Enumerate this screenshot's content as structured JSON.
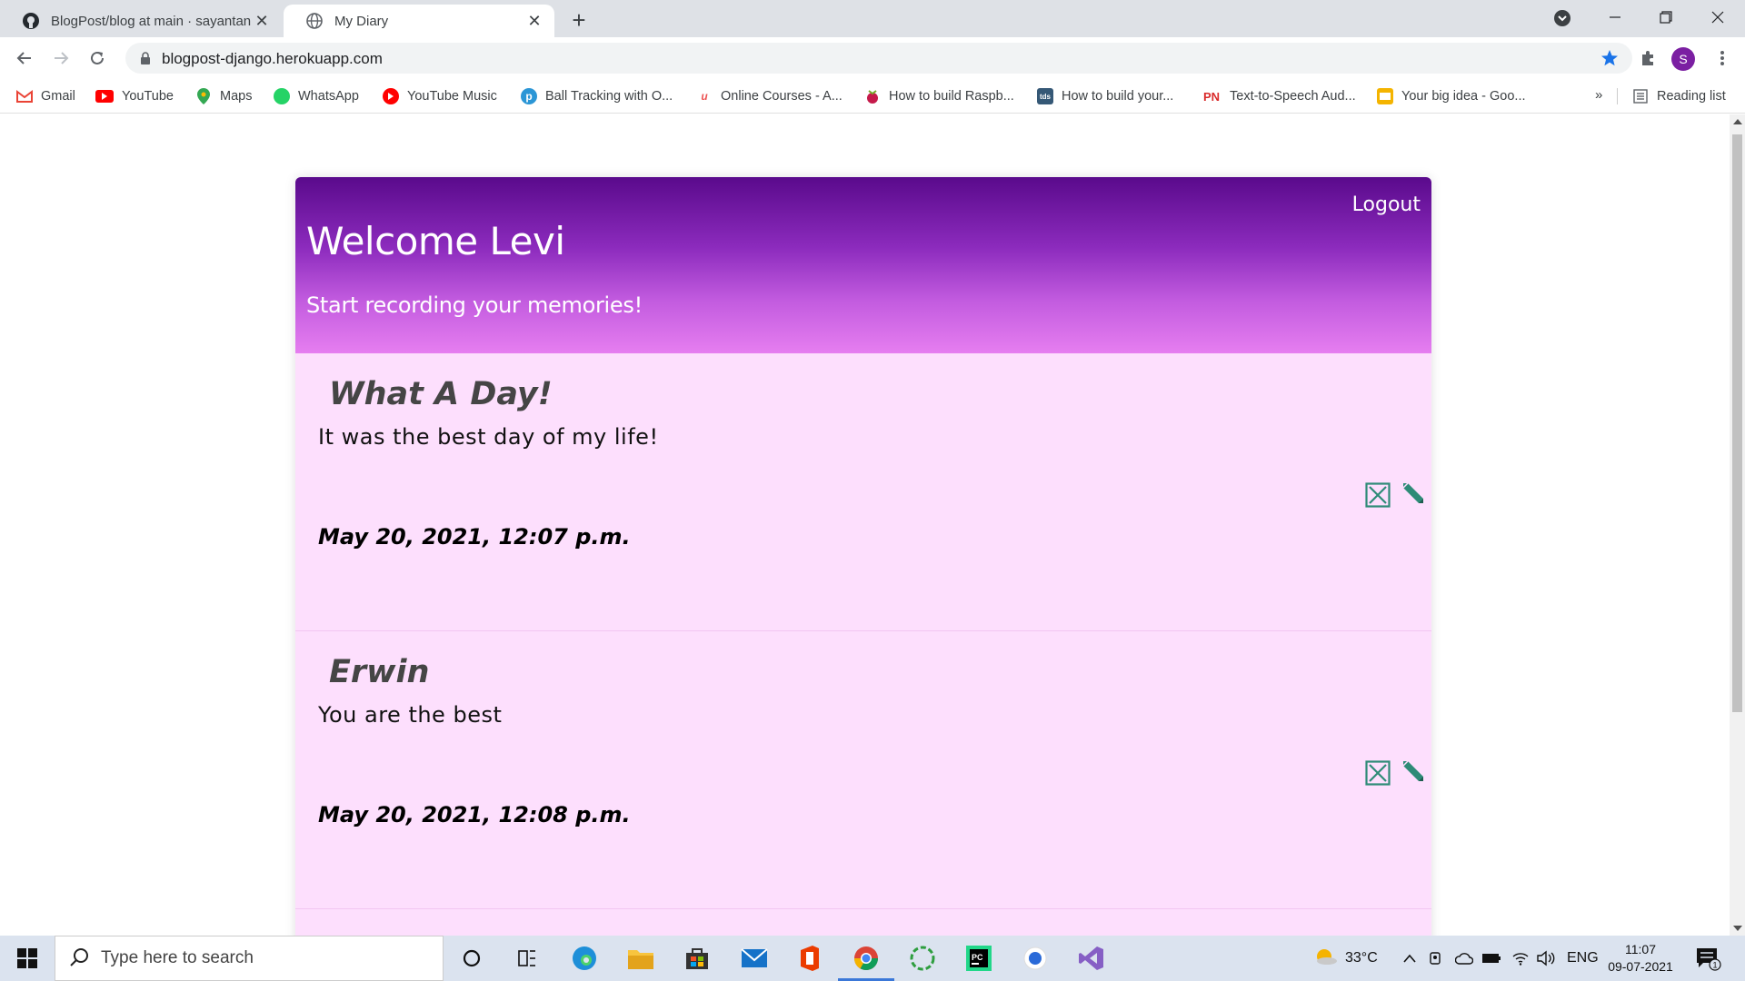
{
  "browser": {
    "tabs": [
      {
        "title": "BlogPost/blog at main · sayantan",
        "favicon": "github-icon",
        "active": false
      },
      {
        "title": "My Diary",
        "favicon": "globe-icon",
        "active": true
      }
    ],
    "url": "blogpost-django.herokuapp.com",
    "profile_initial": "S",
    "bookmarks": [
      {
        "label": "Gmail",
        "icon": "gmail-icon"
      },
      {
        "label": "YouTube",
        "icon": "youtube-icon"
      },
      {
        "label": "Maps",
        "icon": "maps-icon"
      },
      {
        "label": "WhatsApp",
        "icon": "whatsapp-icon"
      },
      {
        "label": "YouTube Music",
        "icon": "youtube-music-icon"
      },
      {
        "label": "Ball Tracking with O...",
        "icon": "bookmark-p-icon"
      },
      {
        "label": "Online Courses - A...",
        "icon": "udemy-icon"
      },
      {
        "label": "How to build Raspb...",
        "icon": "raspberry-icon"
      },
      {
        "label": "How to build your...",
        "icon": "tds-icon"
      },
      {
        "label": "Text-to-Speech Aud...",
        "icon": "pn-icon"
      },
      {
        "label": "Your big idea - Goo...",
        "icon": "slides-icon"
      }
    ],
    "bookmarks_more": "»",
    "reading_list": "Reading list"
  },
  "page": {
    "logout": "Logout",
    "welcome": "Welcome Levi",
    "subtitle": "Start recording your memories!",
    "entries": [
      {
        "title": "What A Day!",
        "body": "It was the best day of my life!",
        "date": "May 20, 2021, 12:07 p.m."
      },
      {
        "title": "Erwin",
        "body": "You are the best",
        "date": "May 20, 2021, 12:08 p.m."
      }
    ]
  },
  "taskbar": {
    "search_placeholder": "Type here to search",
    "weather": "33°C",
    "language": "ENG",
    "time": "11:07",
    "date": "09-07-2021",
    "notification_count": "1"
  },
  "colors": {
    "header_top": "#5a0a8c",
    "header_bottom": "#e67ef0",
    "card_bg": "#fddffd",
    "icon_teal": "#2e8b77"
  }
}
